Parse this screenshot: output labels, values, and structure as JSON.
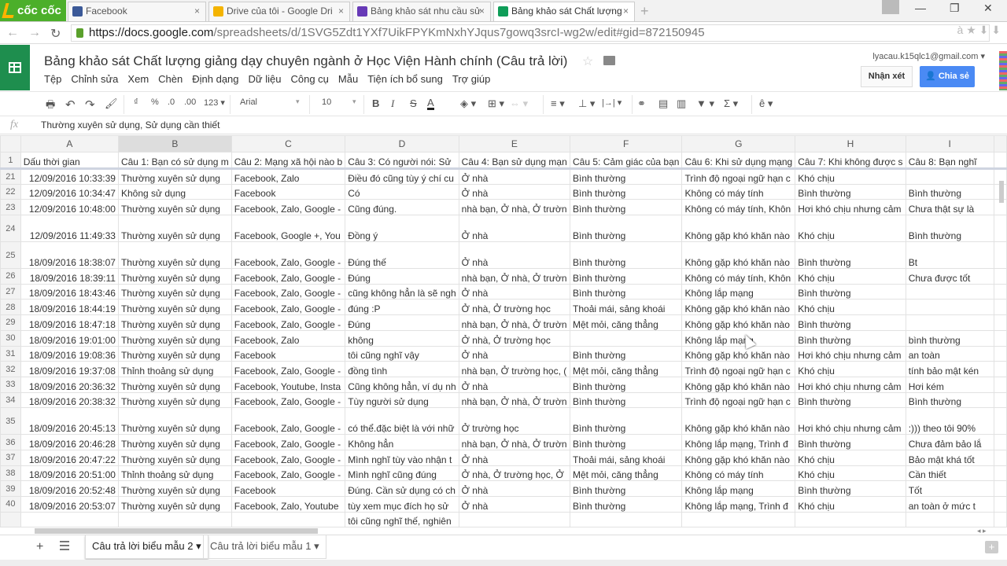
{
  "browser": {
    "brand": "cốc cốc",
    "tabs": [
      {
        "label": "Facebook",
        "color": "#3b5998",
        "active": false
      },
      {
        "label": "Drive của tôi - Google Dri",
        "color": "#f4b400",
        "active": false
      },
      {
        "label": "Bảng khảo sát nhu cầu sử",
        "color": "#673ab7",
        "active": false
      },
      {
        "label": "Bảng khảo sát Chất lượng",
        "color": "#0f9d58",
        "active": true
      }
    ],
    "close_glyph": "×",
    "new_tab_glyph": "+",
    "window_controls": {
      "minimize": "—",
      "restore": "❐",
      "close": "✕"
    },
    "url_host": "https://docs.google.com",
    "url_path": "/spreadsheets/d/1SVG5Zdt1YXf7UikFPYKmNxhYJqus7gowq3srcI-wg2w/edit#gid=872150945",
    "url_icons": "à ★ ⬇ ⬇"
  },
  "doc": {
    "title": "Bảng khảo sát  Chất lượng giảng dạy chuyên ngành ở Học Viện Hành chính (Câu trả lời)",
    "star_glyph": "☆",
    "menu": [
      "Tệp",
      "Chỉnh sửa",
      "Xem",
      "Chèn",
      "Định dạng",
      "Dữ liệu",
      "Công cụ",
      "Mẫu",
      "Tiện ích bổ sung",
      "Trợ giúp"
    ],
    "account": "lyacau.k15qlc1@gmail.com ▾",
    "comment_label": "Nhận xét",
    "share_label": "Chia sẻ"
  },
  "toolbar": {
    "print": "🖶",
    "undo": "↶",
    "redo": "↷",
    "paint_format": "🖌",
    "currency": "₫",
    "percent": "%",
    "dec_less": ".0",
    "dec_more": ".00",
    "more_formats": "123 ▾",
    "font": "Arial",
    "font_size": "10",
    "bold": "B",
    "italic": "I",
    "strike": "S",
    "text_color": "A",
    "fill": "◈ ▾",
    "borders": "⊞ ▾",
    "merge": "⇔ ▾",
    "halign": "≡ ▾",
    "valign": "⊥ ▾",
    "wrap": "|→| ▾",
    "link": "⚭",
    "comment": "▤",
    "chart": "▥",
    "filter": "▼ ▾",
    "functions": "Σ ▾",
    "input_tools": "ê ▾"
  },
  "formula_bar": {
    "fx": "fx",
    "value": "Thường xuyên sử dụng, Sử dụng cần thiết"
  },
  "sheet": {
    "columns": [
      "A",
      "B",
      "C",
      "D",
      "E",
      "F",
      "G",
      "H",
      "I"
    ],
    "selected_column": "B",
    "header_row_number": "1",
    "header": [
      "Dấu thời gian",
      "Câu 1: Bạn có sử dụng m",
      "Câu 2: Mạng xã hội nào b",
      "Câu 3: Có người nói: Sử",
      "Câu 4: Bạn sử dụng mạn",
      "Câu 5: Cảm giác của bạn",
      "Câu 6: Khi sử dụng mạng",
      "Câu 7: Khi không được s",
      "Câu 8: Bạn nghĩ"
    ],
    "rows": [
      {
        "n": "21",
        "tall": false,
        "cells": [
          "12/09/2016 10:33:39",
          "Thường xuyên sử dụng",
          "Facebook, Zalo",
          "Điều đó cũng tùy ý chí cu",
          "Ở nhà",
          "Bình thường",
          "Trình độ ngoại ngữ hạn c",
          "Khó chịu",
          ""
        ]
      },
      {
        "n": "22",
        "tall": false,
        "cells": [
          "12/09/2016 10:34:47",
          "Không sử dụng",
          "Facebook",
          "Có",
          "Ở nhà",
          "Bình thường",
          "Không có máy tính",
          "Bình thường",
          "Bình thường"
        ]
      },
      {
        "n": "23",
        "tall": false,
        "cells": [
          "12/09/2016 10:48:00",
          "Thường xuyên sử dụng",
          "Facebook, Zalo, Google -",
          "Cũng đúng.",
          "nhà bạn, Ở nhà, Ở trườn",
          "Bình thường",
          "Không có máy tính, Khôn",
          "Hơi khó chịu nhưng cảm",
          "Chưa thật sự là"
        ]
      },
      {
        "n": "24",
        "tall": true,
        "cells": [
          "12/09/2016 11:49:33",
          "Thường xuyên sử dụng",
          "Facebook, Google +, You",
          "Đồng ý",
          "Ở nhà",
          "Bình thường",
          "Không gặp khó khăn nào",
          "Khó chịu",
          "Bình thường"
        ]
      },
      {
        "n": "25",
        "tall": true,
        "cells": [
          "18/09/2016 18:38:07",
          "Thường xuyên sử dụng",
          "Facebook, Zalo, Google -",
          "Đúng thế",
          "Ở nhà",
          "Bình thường",
          "Không gặp khó khăn nào",
          "Bình thường",
          "Bt"
        ]
      },
      {
        "n": "26",
        "tall": false,
        "cells": [
          "18/09/2016 18:39:11",
          "Thường xuyên sử dụng",
          "Facebook, Zalo, Google -",
          "Đúng",
          "nhà bạn, Ở nhà, Ở trườn",
          "Bình thường",
          "Không có máy tính, Khôn",
          "Khó chịu",
          "Chưa được tốt"
        ]
      },
      {
        "n": "27",
        "tall": false,
        "cells": [
          "18/09/2016 18:43:46",
          "Thường xuyên sử dụng",
          "Facebook, Zalo, Google -",
          "cũng không hẳn là sẽ ngh",
          "Ở nhà",
          "Bình thường",
          "Không lắp mạng",
          "Bình thường",
          ""
        ]
      },
      {
        "n": "28",
        "tall": false,
        "cells": [
          "18/09/2016 18:44:19",
          "Thường xuyên sử dụng",
          "Facebook, Zalo, Google -",
          "đúng :P",
          "Ở nhà, Ở trường học",
          "Thoải mái, sảng khoái",
          "Không gặp khó khăn nào",
          "Khó chịu",
          ""
        ]
      },
      {
        "n": "29",
        "tall": false,
        "cells": [
          "18/09/2016 18:47:18",
          "Thường xuyên sử dụng",
          "Facebook, Zalo, Google -",
          "Đúng",
          "nhà bạn, Ở nhà, Ở trườn",
          "Mệt mỏi, căng thẳng",
          "Không gặp khó khăn nào",
          "Bình thường",
          ""
        ]
      },
      {
        "n": "30",
        "tall": false,
        "cells": [
          "18/09/2016 19:01:00",
          "Thường xuyên sử dụng",
          "Facebook, Zalo",
          "không",
          "Ở nhà, Ở trường học",
          "",
          "Không lắp mạng",
          "Bình thường",
          "bình thường"
        ]
      },
      {
        "n": "31",
        "tall": false,
        "cells": [
          "18/09/2016 19:08:36",
          "Thường xuyên sử dụng",
          "Facebook",
          "tôi cũng nghĩ vậy",
          "Ở nhà",
          "Bình thường",
          "Không gặp khó khăn nào",
          "Hơi khó chịu nhưng cảm",
          "an toàn"
        ]
      },
      {
        "n": "32",
        "tall": false,
        "cells": [
          "18/09/2016 19:37:08",
          "Thỉnh thoảng sử dụng",
          "Facebook, Zalo, Google -",
          "đồng tình",
          "nhà bạn, Ở trường học, (",
          "Mệt mỏi, căng thẳng",
          "Trình độ ngoại ngữ hạn c",
          "Khó chịu",
          "tính bảo mật kén"
        ]
      },
      {
        "n": "33",
        "tall": false,
        "cells": [
          "18/09/2016 20:36:32",
          "Thường xuyên sử dụng",
          "Facebook, Youtube, Insta",
          "Cũng không hẳn, ví dụ nh",
          "Ở nhà",
          "Bình thường",
          "Không gặp khó khăn nào",
          "Hơi khó chịu nhưng cảm",
          "Hơi kém"
        ]
      },
      {
        "n": "34",
        "tall": false,
        "cells": [
          "18/09/2016 20:38:32",
          "Thường xuyên sử dụng",
          "Facebook, Zalo, Google -",
          "Tùy người sử dụng",
          "nhà bạn, Ở nhà, Ở trườn",
          "Bình thường",
          "Trình độ ngoại ngữ hạn c",
          "Bình thường",
          "Bình thường"
        ]
      },
      {
        "n": "35",
        "tall": true,
        "cells": [
          "18/09/2016 20:45:13",
          "Thường xuyên sử dụng",
          "Facebook, Zalo, Google -",
          "có thể.đặc biệt là với nhữ",
          "Ở trường học",
          "Bình thường",
          "Không gặp khó khăn nào",
          "Hơi khó chịu nhưng cảm",
          ":))) theo tôi 90%"
        ]
      },
      {
        "n": "36",
        "tall": false,
        "cells": [
          "18/09/2016 20:46:28",
          "Thường xuyên sử dụng",
          "Facebook, Zalo, Google -",
          "Không hẳn",
          "nhà bạn, Ở nhà, Ở trườn",
          "Bình thường",
          "Không lắp mạng, Trình đ",
          "Bình thường",
          "Chưa đảm bảo lắ"
        ]
      },
      {
        "n": "37",
        "tall": false,
        "cells": [
          "18/09/2016 20:47:22",
          "Thường xuyên sử dụng",
          "Facebook, Zalo, Google -",
          "Mình nghĩ tùy vào nhận t",
          "Ở nhà",
          "Thoải mái, sảng khoái",
          "Không gặp khó khăn nào",
          "Khó chịu",
          "Bảo mật khá tốt"
        ]
      },
      {
        "n": "38",
        "tall": false,
        "cells": [
          "18/09/2016 20:51:00",
          "Thỉnh thoảng sử dụng",
          "Facebook, Zalo, Google -",
          "Mình nghĩ cũng đúng",
          "Ở nhà, Ở trường học, Ở",
          "Mệt mỏi, căng thẳng",
          "Không có máy tính",
          "Khó chịu",
          "Cần thiết"
        ]
      },
      {
        "n": "39",
        "tall": false,
        "cells": [
          "18/09/2016 20:52:48",
          "Thường xuyên sử dụng",
          "Facebook",
          "Đúng. Cần sử dụng có ch",
          "Ở nhà",
          "Bình thường",
          "Không lắp mạng",
          "Bình thường",
          "Tốt"
        ]
      },
      {
        "n": "40",
        "tall": false,
        "cells": [
          "18/09/2016 20:53:07",
          "Thường xuyên sử dụng",
          "Facebook, Zalo, Youtube",
          "tùy xem mục đích họ sử",
          "Ở nhà",
          "Bình thường",
          "Không lắp mạng, Trình đ",
          "Khó chịu",
          "an toàn ở mức t"
        ]
      },
      {
        "n": "",
        "tall": false,
        "cells": [
          "",
          "",
          "",
          "tôi cũng nghĩ thế, nghiên",
          "",
          "",
          "",
          "",
          ""
        ]
      }
    ]
  },
  "sheet_tabs": {
    "add_glyph": "+",
    "tabs": [
      {
        "label": "Câu trả lời biểu mẫu 2 ▾",
        "active": true
      },
      {
        "label": "Câu trả lời biểu mẫu 1 ▾",
        "active": false
      }
    ],
    "explore_glyph": "+",
    "scroll_arrows": "◂ ▸"
  }
}
